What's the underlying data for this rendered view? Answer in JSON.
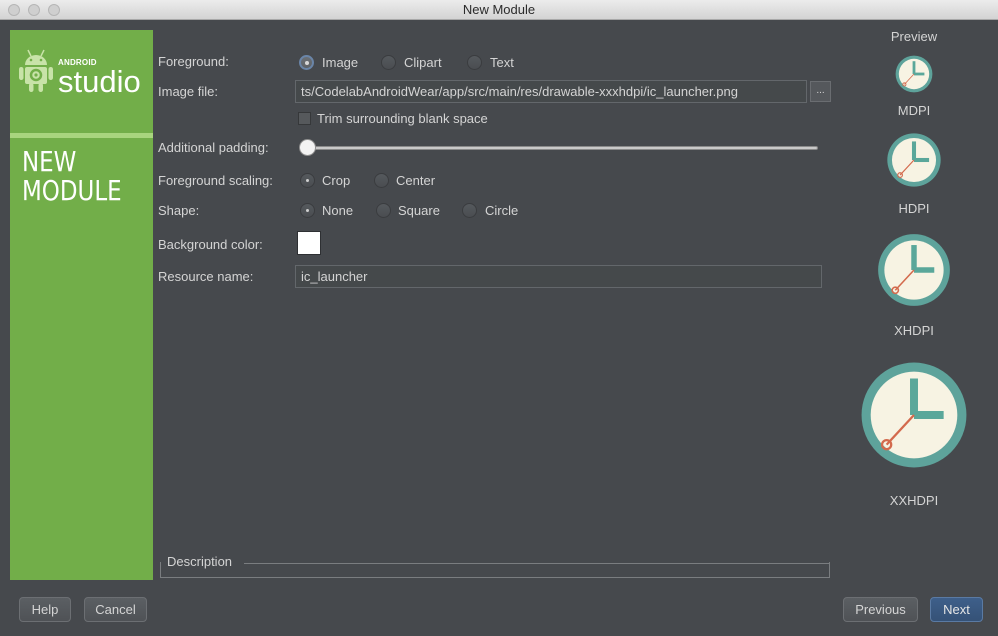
{
  "window": {
    "title": "New Module"
  },
  "sidebar": {
    "brand_small": "ANDROID",
    "brand_big": "studio",
    "heading_line1": "NEW",
    "heading_line2": "MODULE"
  },
  "form": {
    "foreground": {
      "label": "Foreground:",
      "options": [
        "Image",
        "Clipart",
        "Text"
      ],
      "selected": "Image"
    },
    "image_file": {
      "label": "Image file:",
      "value": "ts/CodelabAndroidWear/app/src/main/res/drawable-xxxhdpi/ic_launcher.png",
      "browse_label": "..."
    },
    "trim": {
      "label": "Trim surrounding blank space",
      "checked": false
    },
    "padding": {
      "label": "Additional padding:",
      "value_percent": 0
    },
    "scaling": {
      "label": "Foreground scaling:",
      "options": [
        "Crop",
        "Center"
      ],
      "selected": "Crop"
    },
    "shape": {
      "label": "Shape:",
      "options": [
        "None",
        "Square",
        "Circle"
      ],
      "selected": "None"
    },
    "background_color": {
      "label": "Background color:",
      "value": "#ffffff"
    },
    "resource_name": {
      "label": "Resource name:",
      "value": "ic_launcher"
    }
  },
  "preview": {
    "title": "Preview",
    "densities": [
      "MDPI",
      "HDPI",
      "XHDPI",
      "XXHDPI"
    ],
    "icon_name": "clock-icon",
    "colors": {
      "ring": "#5ea39b",
      "face": "#f7f3e3",
      "hands": "#5aa79a",
      "second_hand": "#d36a4d"
    }
  },
  "description": {
    "label": "Description"
  },
  "buttons": {
    "help": "Help",
    "cancel": "Cancel",
    "previous": "Previous",
    "next": "Next"
  },
  "theme": {
    "sidebar_green": "#72ae49",
    "background": "#46494d",
    "primary_button": "#3e5f8a"
  }
}
